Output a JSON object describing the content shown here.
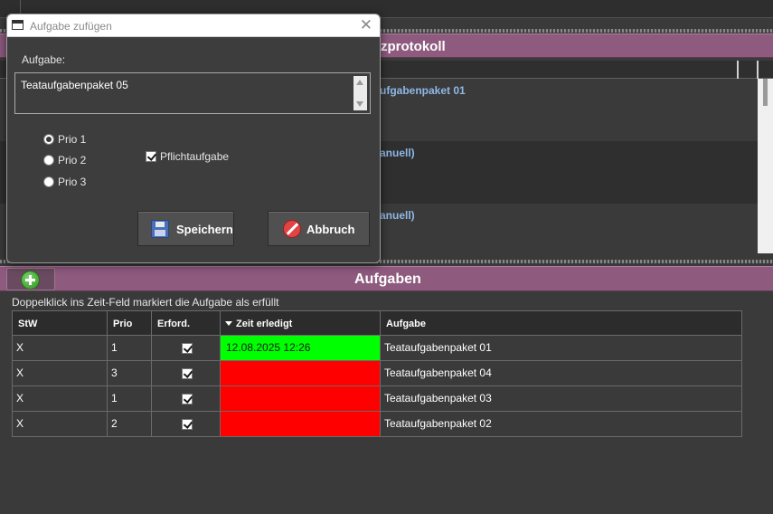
{
  "upper_panel": {
    "title": "zprotokoll",
    "rows": [
      {
        "text": "ufgabenpaket 01"
      },
      {
        "text": "anuell)"
      },
      {
        "text": "anuell)"
      }
    ]
  },
  "lower_panel": {
    "title": "Aufgaben",
    "add_button_icon": "plus-circle-icon",
    "hint": "Doppelklick ins Zeit-Feld markiert die Aufgabe als erfüllt",
    "columns": [
      "StW",
      "Prio",
      "Erford.",
      "Zeit erledigt",
      "Aufgabe"
    ],
    "rows": [
      {
        "stw": "X",
        "prio": "1",
        "erford": true,
        "zeit": "12.08.2025 12:26",
        "status_color": "#00ff00",
        "aufgabe": "Teataufgabenpaket 01"
      },
      {
        "stw": "X",
        "prio": "3",
        "erford": true,
        "zeit": "",
        "status_color": "#ff0000",
        "aufgabe": "Teataufgabenpaket 04"
      },
      {
        "stw": "X",
        "prio": "1",
        "erford": true,
        "zeit": "",
        "status_color": "#ff0000",
        "aufgabe": "Teataufgabenpaket 03"
      },
      {
        "stw": "X",
        "prio": "2",
        "erford": true,
        "zeit": "",
        "status_color": "#ff0000",
        "aufgabe": "Teataufgabenpaket 02"
      }
    ]
  },
  "dialog": {
    "title": "Aufgabe zufügen",
    "close_glyph": "✕",
    "task_label": "Aufgabe:",
    "task_value": "Teataufgabenpaket 05",
    "prio_options": [
      "Prio 1",
      "Prio 2",
      "Prio 3"
    ],
    "prio_selected": "Prio 1",
    "mandatory_label": "Pflichtaufgabe",
    "mandatory_checked": true,
    "save_label": "Speichern",
    "cancel_label": "Abbruch"
  },
  "colors": {
    "header_purple": "#8e5a7e",
    "background": "#3a3a3a",
    "done_green": "#00ff00",
    "open_red": "#ff0000"
  }
}
